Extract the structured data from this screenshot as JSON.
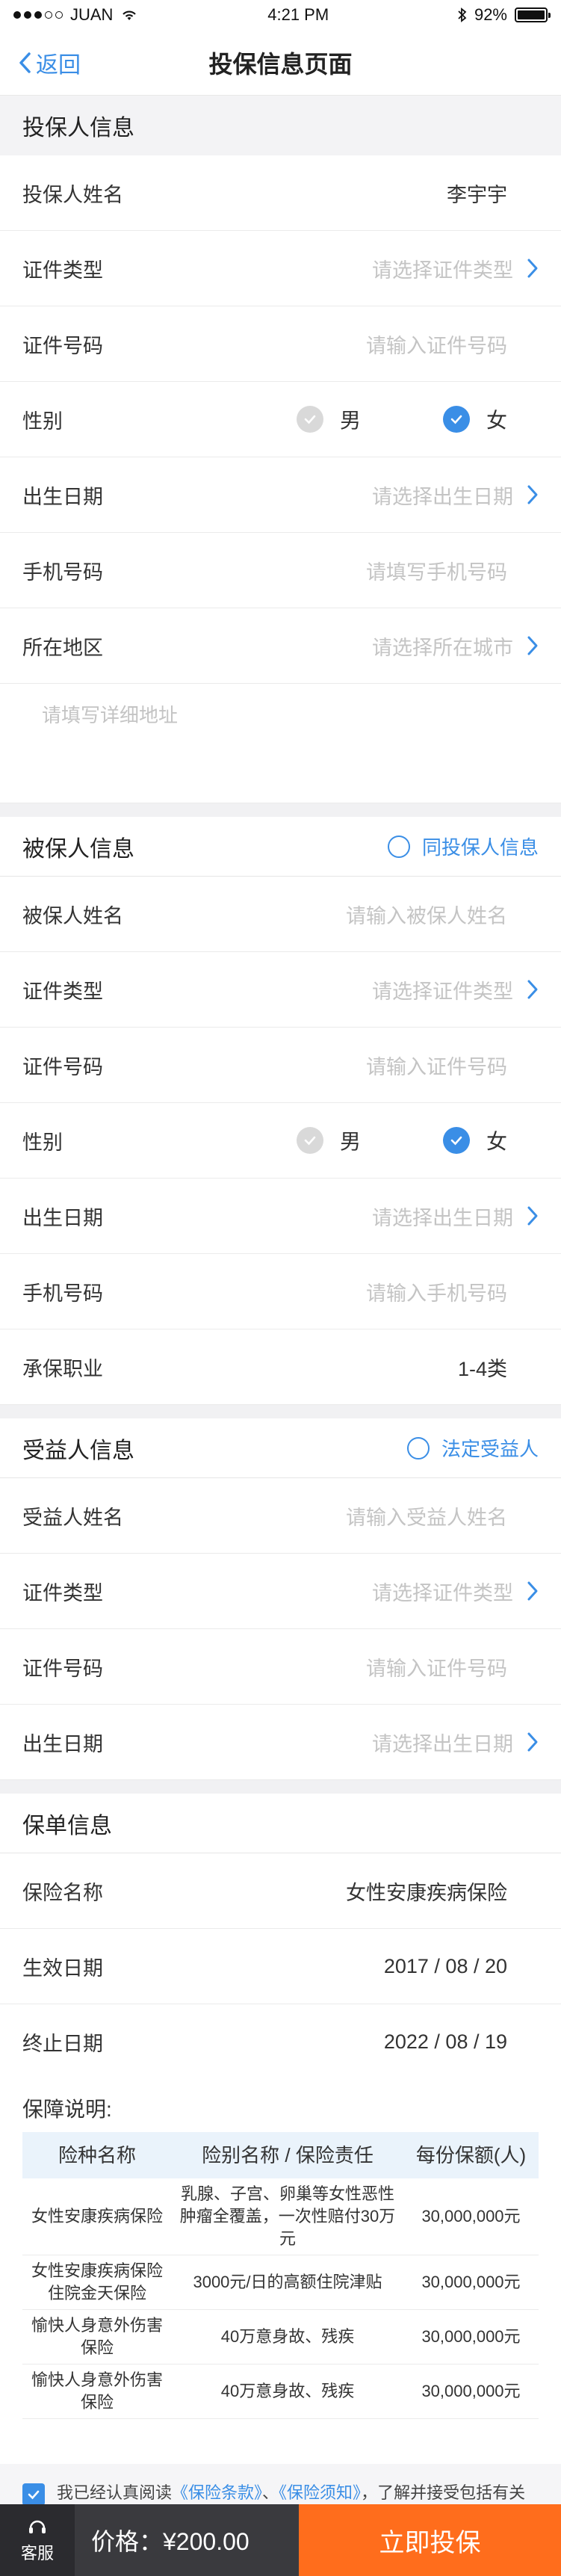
{
  "status": {
    "carrier": "JUAN",
    "time": "4:21 PM",
    "battery": "92%"
  },
  "nav": {
    "back": "返回",
    "title": "投保信息页面"
  },
  "policyholder": {
    "title": "投保人信息",
    "name_label": "投保人姓名",
    "name_value": "李宇宇",
    "idtype_label": "证件类型",
    "idtype_ph": "请选择证件类型",
    "idno_label": "证件号码",
    "idno_ph": "请输入证件号码",
    "gender_label": "性别",
    "male": "男",
    "female": "女",
    "birth_label": "出生日期",
    "birth_ph": "请选择出生日期",
    "phone_label": "手机号码",
    "phone_ph": "请填写手机号码",
    "region_label": "所在地区",
    "region_ph": "请选择所在城市",
    "address_ph": "请填写详细地址"
  },
  "insured": {
    "title": "被保人信息",
    "same_label": "同投保人信息",
    "name_label": "被保人姓名",
    "name_ph": "请输入被保人姓名",
    "idtype_label": "证件类型",
    "idtype_ph": "请选择证件类型",
    "idno_label": "证件号码",
    "idno_ph": "请输入证件号码",
    "gender_label": "性别",
    "male": "男",
    "female": "女",
    "birth_label": "出生日期",
    "birth_ph": "请选择出生日期",
    "phone_label": "手机号码",
    "phone_ph": "请输入手机号码",
    "job_label": "承保职业",
    "job_value": "1-4类"
  },
  "beneficiary": {
    "title": "受益人信息",
    "legal_label": "法定受益人",
    "name_label": "受益人姓名",
    "name_ph": "请输入受益人姓名",
    "idtype_label": "证件类型",
    "idtype_ph": "请选择证件类型",
    "idno_label": "证件号码",
    "idno_ph": "请输入证件号码",
    "birth_label": "出生日期",
    "birth_ph": "请选择出生日期"
  },
  "policy": {
    "title": "保单信息",
    "name_label": "保险名称",
    "name_value": "女性安康疾病保险",
    "start_label": "生效日期",
    "start_value": "2017 / 08 / 20",
    "end_label": "终止日期",
    "end_value": "2022 / 08 / 19",
    "coverage_title": "保障说明:",
    "headers": [
      "险种名称",
      "险别名称 / 保险责任",
      "每份保额(人)"
    ],
    "rows": [
      {
        "name": "女性安康疾病保险",
        "desc": "乳腺、子宫、卵巢等女性恶性肿瘤全覆盖，一次性赔付30万元",
        "amount": "30,000,000元"
      },
      {
        "name": "女性安康疾病保险住院金天保险",
        "desc": "3000元/日的高额住院津贴",
        "amount": "30,000,000元"
      },
      {
        "name": "愉快人身意外伤害保险",
        "desc": "40万意身故、残疾",
        "amount": "30,000,000元"
      },
      {
        "name": "愉快人身意外伤害保险",
        "desc": "40万意身故、残疾",
        "amount": "30,000,000元"
      }
    ]
  },
  "agreement": {
    "prefix": "我已经认真阅读",
    "link1": "《保险条款》",
    "sep": "、",
    "link2": "《保险须知》",
    "suffix": "，了解并接受包括有关责任条款及免除责任条款等约定。"
  },
  "bottom": {
    "service": "客服",
    "price": "价格：¥200.00",
    "buy": "立即投保"
  },
  "colors": {
    "accent": "#3a8ee6",
    "buy": "#ff6d1c"
  }
}
